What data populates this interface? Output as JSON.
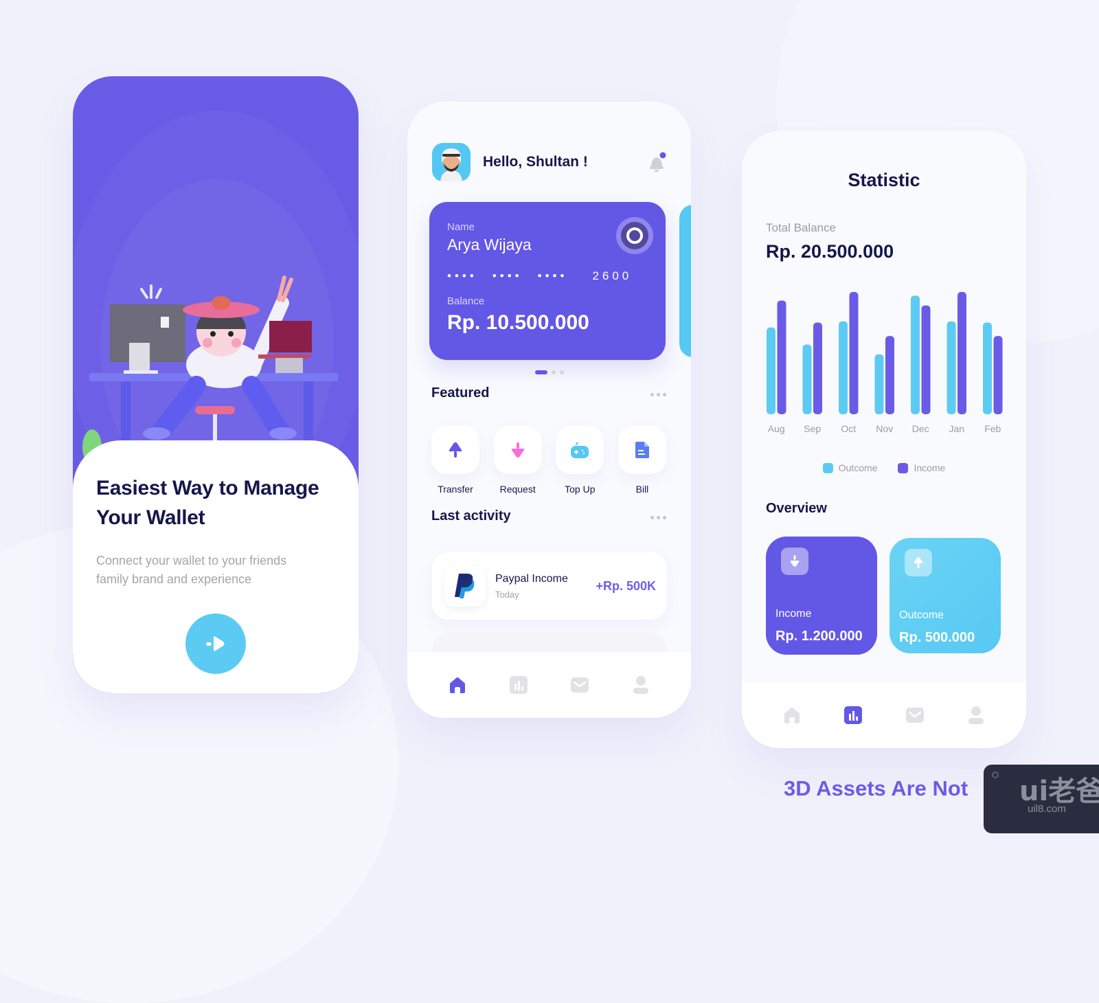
{
  "onboarding": {
    "headline_line1": "Easiest Way to Manage",
    "headline_line2": "Your Wallet",
    "subtitle_line1": "Connect your wallet to your friends",
    "subtitle_line2": "family brand and experience",
    "next_button_icon": "arrow-right-icon",
    "illustration": "person-at-desk-3d-illustration"
  },
  "home": {
    "greeting": "Hello, Shultan !",
    "notification_icon": "bell-icon",
    "card": {
      "name_label": "Name",
      "name": "Arya Wijaya",
      "masked_groups": [
        "••••",
        "••••",
        "••••"
      ],
      "last_digits": "2600",
      "balance_label": "Balance",
      "balance": "Rp. 10.500.000"
    },
    "carousel": {
      "count": 3,
      "active": 1
    },
    "featured": {
      "title": "Featured",
      "items": [
        {
          "label": "Transfer",
          "icon": "transfer-up-icon",
          "color": "#6357e6"
        },
        {
          "label": "Request",
          "icon": "request-down-icon",
          "color": "#f56fd8"
        },
        {
          "label": "Top Up",
          "icon": "gamepad-icon",
          "color": "#55c8f4"
        },
        {
          "label": "Bill",
          "icon": "document-icon",
          "color": "#5d7ef0"
        }
      ]
    },
    "last_activity": {
      "title": "Last activity",
      "items": [
        {
          "title": "Paypal Income",
          "date": "Today",
          "amount": "+Rp. 500K",
          "icon": "paypal-icon"
        }
      ]
    },
    "nav": [
      {
        "name": "home",
        "icon": "home-icon",
        "active": true
      },
      {
        "name": "statistic",
        "icon": "chart-icon",
        "active": false
      },
      {
        "name": "messages",
        "icon": "mail-icon",
        "active": false
      },
      {
        "name": "profile",
        "icon": "user-icon",
        "active": false
      }
    ]
  },
  "statistic": {
    "title": "Statistic",
    "total_label": "Total Balance",
    "total_value": "Rp. 20.500.000",
    "overview_title": "Overview",
    "overview": [
      {
        "label": "Income",
        "value": "Rp. 1.200.000",
        "color": "#6357e6"
      },
      {
        "label": "Outcome",
        "value": "Rp. 500.000",
        "color": "#5ccbf3"
      }
    ],
    "nav": [
      {
        "name": "home",
        "icon": "home-icon",
        "active": false
      },
      {
        "name": "statistic",
        "icon": "chart-icon",
        "active": true
      },
      {
        "name": "messages",
        "icon": "mail-icon",
        "active": false
      },
      {
        "name": "profile",
        "icon": "user-icon",
        "active": false
      }
    ]
  },
  "chart_data": {
    "type": "bar",
    "title": "",
    "xlabel": "",
    "ylabel": "",
    "categories": [
      "Aug",
      "Sep",
      "Oct",
      "Nov",
      "Dec",
      "Jan",
      "Feb"
    ],
    "series": [
      {
        "name": "Outcome",
        "color": "#5ccbf3",
        "values": [
          71,
          57,
          76,
          49,
          97,
          76,
          75
        ]
      },
      {
        "name": "Income",
        "color": "#6a5be6",
        "values": [
          93,
          75,
          100,
          64,
          89,
          100,
          64
        ]
      }
    ],
    "ylim": [
      0,
      100
    ],
    "grid": false,
    "legend": "bottom-center",
    "note": "values relative (% of tallest bar); no y-axis shown"
  },
  "colors": {
    "primary": "#6357e6",
    "accent": "#5ccbf3",
    "text_dark": "#15174a",
    "text_muted": "#a0a0aa"
  },
  "footer": {
    "caption": "3D Assets Are Not",
    "watermark_logo": "ui老爸",
    "watermark_domain": "uil8.com"
  }
}
